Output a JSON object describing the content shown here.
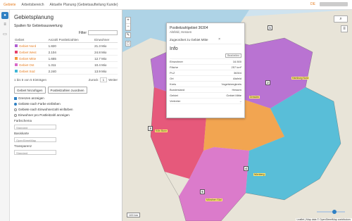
{
  "topbar": {
    "brand": "Gebiete",
    "crumbs": [
      "Arbeitsbereich",
      "Aktuelle Planung (Gebietsaufteilung Kunde)"
    ],
    "lang": "DE"
  },
  "rail": {
    "items": [
      "home-icon",
      "layers-icon",
      "folder-icon"
    ]
  },
  "panel": {
    "title": "Gebietsplanung",
    "subtitle": "Spalten für Gebietsauswertung",
    "search_label": "Filter",
    "search_placeholder": "",
    "columns": [
      "Gebiet",
      "Anzahl Postleitzahlen",
      "Einwohner"
    ],
    "rows": [
      {
        "name": "Gebiet Nord",
        "color": "#b05fd1",
        "count": "1.820",
        "value": "21.3 Mio"
      },
      {
        "name": "Gebiet West",
        "color": "#e5416b",
        "count": "2.104",
        "value": "24.8 Mio"
      },
      {
        "name": "Gebiet Mitte",
        "color": "#f39a3a",
        "count": "1.655",
        "value": "12.7 Mio"
      },
      {
        "name": "Gebiet Ost",
        "color": "#d868c9",
        "count": "1.311",
        "value": "10.4 Mio"
      },
      {
        "name": "Gebiet Süd",
        "color": "#3fb7d8",
        "count": "2.240",
        "value": "13.9 Mio"
      }
    ],
    "pager_info": "1 bis 5 von 5 Einträgen",
    "pager_prev": "Zurück",
    "pager_page": "1",
    "pager_next": "Weiter",
    "btn_add": "Gebiet hinzufügen",
    "btn_zip": "Postleitzahlen zuordnen",
    "check_label": "Grenzen anzeigen",
    "radio_options": [
      "Gebiete nach Farbe einfärben",
      "Gebiete nach Einwohnerzahl einfärben",
      "Einwohner pro Postleitzahl anzeigen"
    ],
    "radio_selected": 0,
    "field1_label": "Farbschema",
    "field1_value": "Standard",
    "field2_label": "Basiskarte",
    "field2_value": "OpenStreetMap",
    "field3_label": "Transparenz",
    "field3_value": "Standard"
  },
  "map": {
    "scale": "100 km",
    "attribution": "Leaflet | Map data © OpenStreetMap contributors",
    "markers": [
      "1",
      "2",
      "3",
      "4",
      "5"
    ],
    "labels": [
      "Hamburg Nord",
      "Köln Bonn",
      "Nürnberg",
      "München Süd",
      "Dresden",
      "Stuttgart"
    ]
  },
  "popup": {
    "title": "Postleitzahlgebiet 36304",
    "subtitle": "Alsfeld, Hessen",
    "line": "Zugeordnet zu Gebiet Mitte",
    "info_title": "Info",
    "info_link": "Bearbeiten",
    "rows": [
      {
        "k": "Einwohner",
        "v": "16.500"
      },
      {
        "k": "Fläche",
        "v": "257 km²"
      },
      {
        "k": "PLZ",
        "v": "36304"
      },
      {
        "k": "Ort",
        "v": "Alsfeld"
      },
      {
        "k": "Kreis",
        "v": "Vogelsbergkreis"
      },
      {
        "k": "Bundesland",
        "v": "Hessen"
      },
      {
        "k": "Gebiet",
        "v": "Gebiet Mitte"
      },
      {
        "k": "Vertreter",
        "v": "–"
      }
    ]
  }
}
